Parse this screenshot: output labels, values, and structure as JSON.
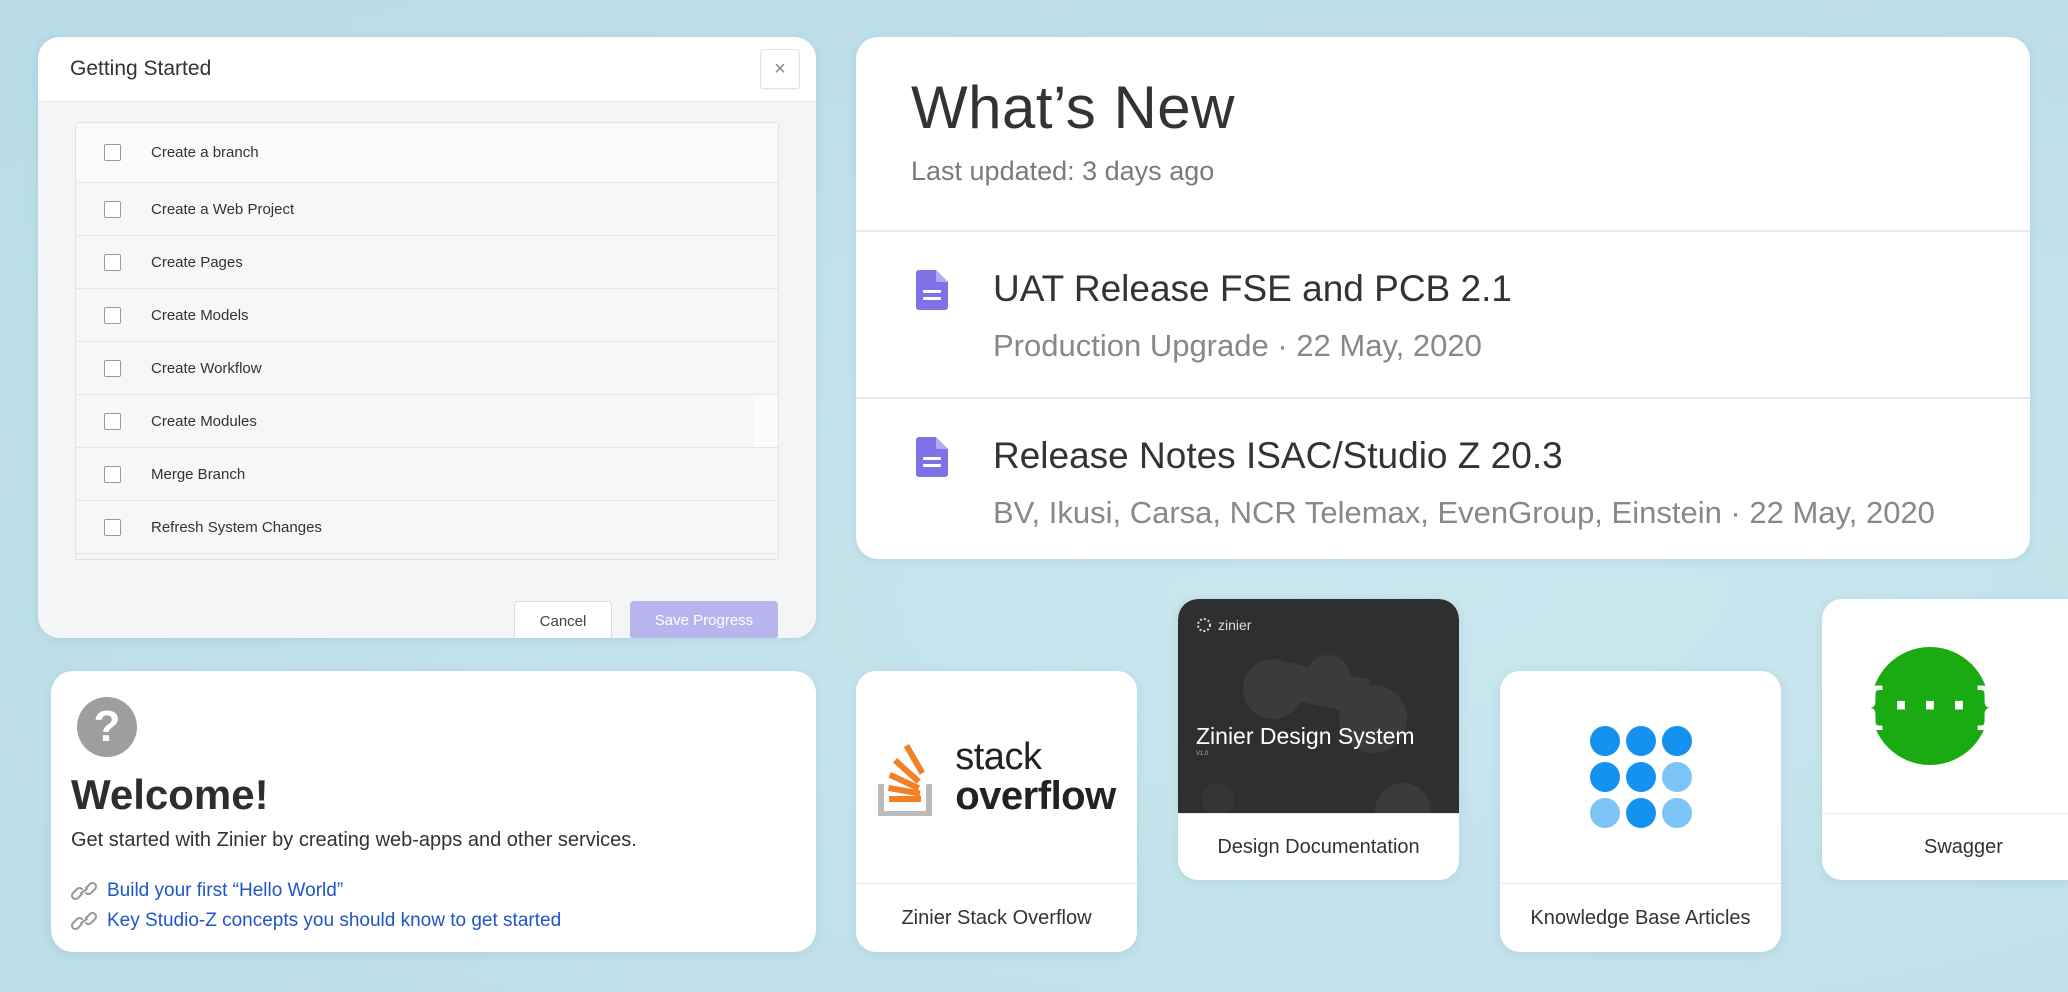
{
  "getting_started": {
    "title": "Getting Started",
    "close_glyph": "×",
    "items": [
      {
        "label": "Create a branch"
      },
      {
        "label": "Create a Web Project"
      },
      {
        "label": "Create Pages"
      },
      {
        "label": "Create Models"
      },
      {
        "label": "Create Workflow"
      },
      {
        "label": "Create Modules"
      },
      {
        "label": "Merge Branch"
      },
      {
        "label": "Refresh System Changes"
      }
    ],
    "cancel_label": "Cancel",
    "save_label": "Save Progress"
  },
  "whats_new": {
    "title": "What’s New",
    "updated": "Last updated: 3 days ago",
    "items": [
      {
        "title": "UAT Release FSE and PCB 2.1",
        "subtitle": "Production Upgrade · 22 May, 2020",
        "icon": "document-icon"
      },
      {
        "title": "Release Notes ISAC/Studio Z 20.3",
        "subtitle": "BV, Ikusi, Carsa, NCR Telemax, EvenGroup, Einstein · 22 May, 2020",
        "icon": "document-icon"
      }
    ]
  },
  "welcome": {
    "icon_glyph": "?",
    "title": "Welcome!",
    "subtitle": "Get started with Zinier by creating web-apps and other services.",
    "links": [
      {
        "label": "Build your first “Hello World”"
      },
      {
        "label": "Key Studio-Z concepts you should know to get started"
      }
    ]
  },
  "tiles": {
    "stack_overflow": {
      "caption": "Zinier Stack Overflow",
      "logo_line1": "stack",
      "logo_line2": "overflow"
    },
    "design_docs": {
      "caption": "Design Documentation",
      "brand": "zinier",
      "art_title": "Zinier Design System",
      "art_version": "V1.0"
    },
    "knowledge_base": {
      "caption": "Knowledge Base Articles"
    },
    "swagger": {
      "caption": "Swagger",
      "glyph": "{···}"
    }
  },
  "colors": {
    "accent_purple": "#7f72e8",
    "save_button": "#b7b4ee",
    "link_blue": "#1e55c8",
    "swagger_green": "#1aaa12",
    "so_orange": "#f48024",
    "kb_blue": "#1592f0",
    "kb_light": "#7cc4f5"
  }
}
